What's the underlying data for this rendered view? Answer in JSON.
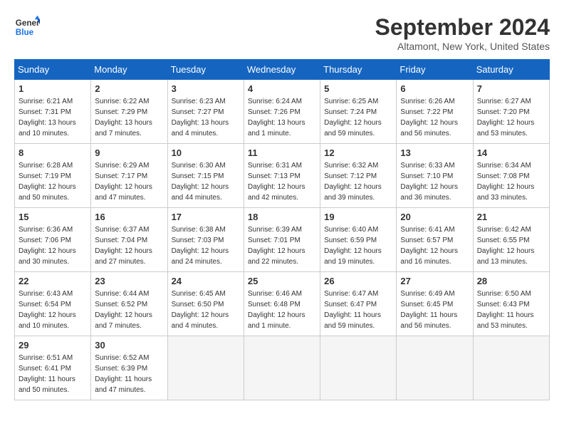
{
  "logo": {
    "line1": "General",
    "line2": "Blue",
    "icon_color": "#1a73e8"
  },
  "title": "September 2024",
  "location": "Altamont, New York, United States",
  "days_of_week": [
    "Sunday",
    "Monday",
    "Tuesday",
    "Wednesday",
    "Thursday",
    "Friday",
    "Saturday"
  ],
  "weeks": [
    [
      {
        "day": 1,
        "info": "Sunrise: 6:21 AM\nSunset: 7:31 PM\nDaylight: 13 hours\nand 10 minutes."
      },
      {
        "day": 2,
        "info": "Sunrise: 6:22 AM\nSunset: 7:29 PM\nDaylight: 13 hours\nand 7 minutes."
      },
      {
        "day": 3,
        "info": "Sunrise: 6:23 AM\nSunset: 7:27 PM\nDaylight: 13 hours\nand 4 minutes."
      },
      {
        "day": 4,
        "info": "Sunrise: 6:24 AM\nSunset: 7:26 PM\nDaylight: 13 hours\nand 1 minute."
      },
      {
        "day": 5,
        "info": "Sunrise: 6:25 AM\nSunset: 7:24 PM\nDaylight: 12 hours\nand 59 minutes."
      },
      {
        "day": 6,
        "info": "Sunrise: 6:26 AM\nSunset: 7:22 PM\nDaylight: 12 hours\nand 56 minutes."
      },
      {
        "day": 7,
        "info": "Sunrise: 6:27 AM\nSunset: 7:20 PM\nDaylight: 12 hours\nand 53 minutes."
      }
    ],
    [
      {
        "day": 8,
        "info": "Sunrise: 6:28 AM\nSunset: 7:19 PM\nDaylight: 12 hours\nand 50 minutes."
      },
      {
        "day": 9,
        "info": "Sunrise: 6:29 AM\nSunset: 7:17 PM\nDaylight: 12 hours\nand 47 minutes."
      },
      {
        "day": 10,
        "info": "Sunrise: 6:30 AM\nSunset: 7:15 PM\nDaylight: 12 hours\nand 44 minutes."
      },
      {
        "day": 11,
        "info": "Sunrise: 6:31 AM\nSunset: 7:13 PM\nDaylight: 12 hours\nand 42 minutes."
      },
      {
        "day": 12,
        "info": "Sunrise: 6:32 AM\nSunset: 7:12 PM\nDaylight: 12 hours\nand 39 minutes."
      },
      {
        "day": 13,
        "info": "Sunrise: 6:33 AM\nSunset: 7:10 PM\nDaylight: 12 hours\nand 36 minutes."
      },
      {
        "day": 14,
        "info": "Sunrise: 6:34 AM\nSunset: 7:08 PM\nDaylight: 12 hours\nand 33 minutes."
      }
    ],
    [
      {
        "day": 15,
        "info": "Sunrise: 6:36 AM\nSunset: 7:06 PM\nDaylight: 12 hours\nand 30 minutes."
      },
      {
        "day": 16,
        "info": "Sunrise: 6:37 AM\nSunset: 7:04 PM\nDaylight: 12 hours\nand 27 minutes."
      },
      {
        "day": 17,
        "info": "Sunrise: 6:38 AM\nSunset: 7:03 PM\nDaylight: 12 hours\nand 24 minutes."
      },
      {
        "day": 18,
        "info": "Sunrise: 6:39 AM\nSunset: 7:01 PM\nDaylight: 12 hours\nand 22 minutes."
      },
      {
        "day": 19,
        "info": "Sunrise: 6:40 AM\nSunset: 6:59 PM\nDaylight: 12 hours\nand 19 minutes."
      },
      {
        "day": 20,
        "info": "Sunrise: 6:41 AM\nSunset: 6:57 PM\nDaylight: 12 hours\nand 16 minutes."
      },
      {
        "day": 21,
        "info": "Sunrise: 6:42 AM\nSunset: 6:55 PM\nDaylight: 12 hours\nand 13 minutes."
      }
    ],
    [
      {
        "day": 22,
        "info": "Sunrise: 6:43 AM\nSunset: 6:54 PM\nDaylight: 12 hours\nand 10 minutes."
      },
      {
        "day": 23,
        "info": "Sunrise: 6:44 AM\nSunset: 6:52 PM\nDaylight: 12 hours\nand 7 minutes."
      },
      {
        "day": 24,
        "info": "Sunrise: 6:45 AM\nSunset: 6:50 PM\nDaylight: 12 hours\nand 4 minutes."
      },
      {
        "day": 25,
        "info": "Sunrise: 6:46 AM\nSunset: 6:48 PM\nDaylight: 12 hours\nand 1 minute."
      },
      {
        "day": 26,
        "info": "Sunrise: 6:47 AM\nSunset: 6:47 PM\nDaylight: 11 hours\nand 59 minutes."
      },
      {
        "day": 27,
        "info": "Sunrise: 6:49 AM\nSunset: 6:45 PM\nDaylight: 11 hours\nand 56 minutes."
      },
      {
        "day": 28,
        "info": "Sunrise: 6:50 AM\nSunset: 6:43 PM\nDaylight: 11 hours\nand 53 minutes."
      }
    ],
    [
      {
        "day": 29,
        "info": "Sunrise: 6:51 AM\nSunset: 6:41 PM\nDaylight: 11 hours\nand 50 minutes."
      },
      {
        "day": 30,
        "info": "Sunrise: 6:52 AM\nSunset: 6:39 PM\nDaylight: 11 hours\nand 47 minutes."
      },
      null,
      null,
      null,
      null,
      null
    ]
  ]
}
